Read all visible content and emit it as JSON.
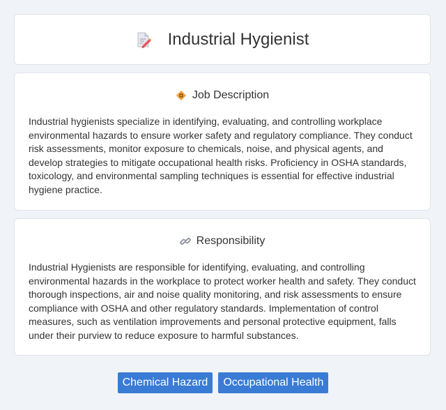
{
  "header": {
    "title": "Industrial Hygienist",
    "icon": "document-pencil-icon"
  },
  "job_description": {
    "heading": "Job Description",
    "icon": "diamond-badge-icon",
    "text": "Industrial hygienists specialize in identifying, evaluating, and controlling workplace environmental hazards to ensure worker safety and regulatory compliance. They conduct risk assessments, monitor exposure to chemicals, noise, and physical agents, and develop strategies to mitigate occupational health risks. Proficiency in OSHA standards, toxicology, and environmental sampling techniques is essential for effective industrial hygiene practice."
  },
  "responsibility": {
    "heading": "Responsibility",
    "icon": "link-icon",
    "text": "Industrial Hygienists are responsible for identifying, evaluating, and controlling environmental hazards in the workplace to protect worker health and safety. They conduct thorough inspections, air and noise quality monitoring, and risk assessments to ensure compliance with OSHA and other regulatory standards. Implementation of control measures, such as ventilation improvements and personal protective equipment, falls under their purview to reduce exposure to harmful substances."
  },
  "tags": [
    {
      "label": "Chemical Hazard"
    },
    {
      "label": "Occupational Health"
    }
  ],
  "colors": {
    "background": "#f0f3f8",
    "card": "#ffffff",
    "tag": "#3a7bd5",
    "text": "#333333"
  }
}
